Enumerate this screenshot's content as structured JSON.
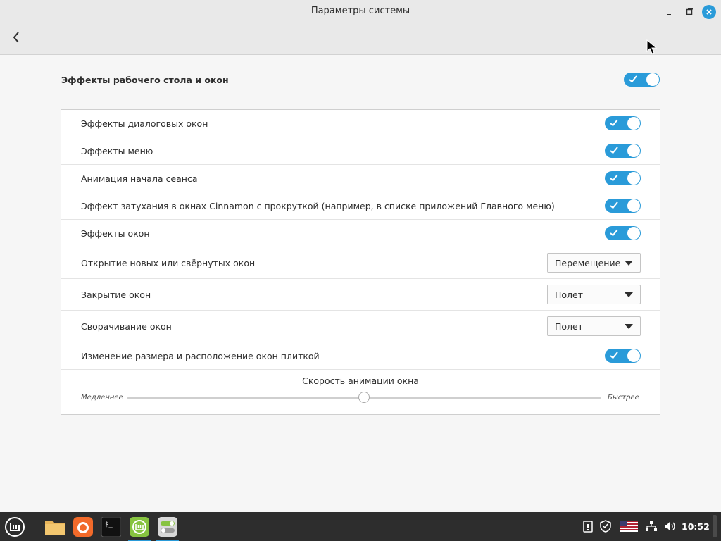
{
  "window": {
    "title": "Параметры системы"
  },
  "master": {
    "label": "Эффекты рабочего стола и окон",
    "enabled": true
  },
  "rows": [
    {
      "label": "Эффекты диалоговых окон",
      "type": "switch",
      "enabled": true
    },
    {
      "label": "Эффекты меню",
      "type": "switch",
      "enabled": true
    },
    {
      "label": "Анимация начала сеанса",
      "type": "switch",
      "enabled": true
    },
    {
      "label": "Эффект затухания в окнах Cinnamon с прокруткой (например, в списке приложений Главного меню)",
      "type": "switch",
      "enabled": true
    },
    {
      "label": "Эффекты окон",
      "type": "switch",
      "enabled": true
    },
    {
      "label": "Открытие новых или свёрнутых окон",
      "type": "combo",
      "value": "Перемещение"
    },
    {
      "label": "Закрытие окон",
      "type": "combo",
      "value": "Полет"
    },
    {
      "label": "Сворачивание окон",
      "type": "combo",
      "value": "Полет"
    },
    {
      "label": "Изменение размера и расположение окон плиткой",
      "type": "switch",
      "enabled": true
    }
  ],
  "speed": {
    "title": "Скорость анимации окна",
    "min_label": "Медленнее",
    "max_label": "Быстрее",
    "value": 0.5
  },
  "taskbar": {
    "apps": [
      "menu-icon",
      "files-icon",
      "firefox-icon",
      "terminal-icon",
      "mintupdate-icon",
      "system-settings-icon"
    ],
    "clock": "10:52"
  },
  "colors": {
    "accent": "#2a9bd9",
    "taskbar": "#2d2d2d"
  }
}
